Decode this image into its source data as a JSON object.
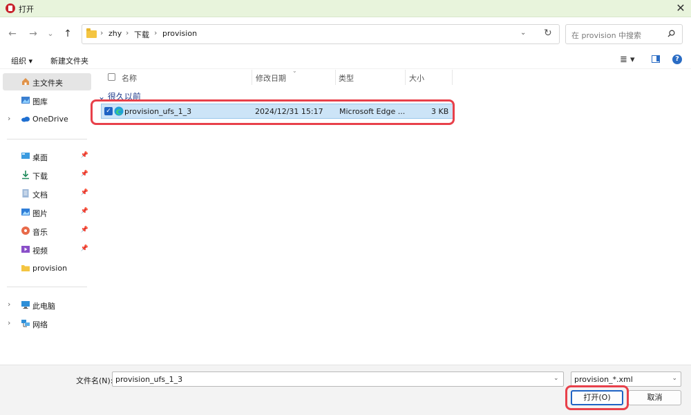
{
  "window": {
    "title": "打开",
    "close_glyph": "✕"
  },
  "nav": {
    "back_glyph": "←",
    "forward_glyph": "→",
    "recent_glyph": "⌄",
    "up_glyph": "↑",
    "breadcrumbs": [
      "zhy",
      "下载",
      "provision"
    ],
    "separator": "›",
    "dropdown_glyph": "⌄",
    "refresh_glyph": "↻",
    "search_placeholder": "在 provision 中搜索"
  },
  "commands": {
    "organize": "组织 ▾",
    "new_folder": "新建文件夹",
    "view_glyph": "≣ ▾",
    "help_glyph": "?"
  },
  "sidebar": {
    "items": [
      {
        "label": "主文件夹",
        "icon": "home-icon"
      },
      {
        "label": "图库",
        "icon": "gallery-icon"
      },
      {
        "label": "OneDrive",
        "icon": "cloud-icon"
      },
      {
        "label": "桌面",
        "icon": "desktop-icon"
      },
      {
        "label": "下载",
        "icon": "download-icon"
      },
      {
        "label": "文档",
        "icon": "document-icon"
      },
      {
        "label": "图片",
        "icon": "picture-icon"
      },
      {
        "label": "音乐",
        "icon": "music-icon"
      },
      {
        "label": "视频",
        "icon": "video-icon"
      },
      {
        "label": "provision",
        "icon": "folder-icon"
      },
      {
        "label": "此电脑",
        "icon": "computer-icon"
      },
      {
        "label": "网络",
        "icon": "network-icon"
      }
    ],
    "chevron": "›",
    "pin": "📌"
  },
  "file_list": {
    "columns": [
      "名称",
      "修改日期",
      "类型",
      "大小"
    ],
    "sort_glyph": "⌄",
    "group": "⌄ 很久以前",
    "files": [
      {
        "name": "provision_ufs_1_3",
        "modified": "2024/12/31 15:17",
        "type": "Microsoft Edge ...",
        "size": "3 KB",
        "check": "✓"
      }
    ]
  },
  "footer": {
    "filename_label": "文件名(N):",
    "filename_value": "provision_ufs_1_3",
    "dropdown_glyph": "⌄",
    "filter": "provision_*.xml",
    "open_button": "打开(O)",
    "cancel_button": "取消"
  },
  "colors": {
    "title_bar": "#e8f4dc",
    "selection": "#cce4f7",
    "highlight": "#e8404a",
    "accent": "#1f63c4"
  }
}
